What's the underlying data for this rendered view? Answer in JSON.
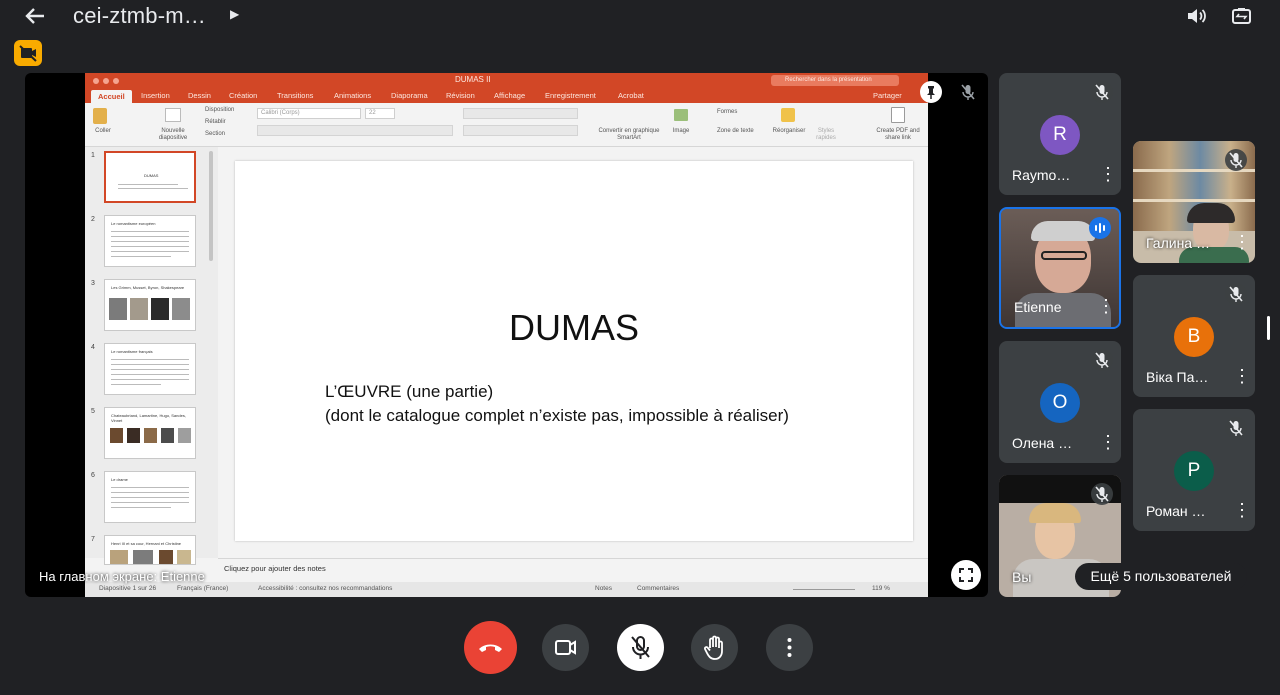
{
  "meeting": {
    "title": "cei-ztmb-m…"
  },
  "presentation": {
    "caption": "На главном экране: Etienne",
    "app": {
      "doc_title": "DUMAS II",
      "search_placeholder": "Rechercher dans la présentation",
      "share": "Partager",
      "tabs": [
        "Accueil",
        "Insertion",
        "Dessin",
        "Création",
        "Transitions",
        "Animations",
        "Diaporama",
        "Révision",
        "Affichage",
        "Enregistrement",
        "Acrobat"
      ],
      "ribbon": {
        "coller": "Coller",
        "nouvelle": "Nouvelle diapositive",
        "disposition": "Disposition",
        "retablir": "Rétablir",
        "section": "Section",
        "font": "Calibri (Corps)",
        "size": "22",
        "convert": "Convertir en graphique SmartArt",
        "image": "Image",
        "formes": "Formes",
        "zone": "Zone de texte",
        "reorg": "Réorganiser",
        "styles": "Styles rapides",
        "pdf": "Create PDF and share link"
      },
      "thumbs": [
        {
          "num": "1",
          "title": "DUMAS"
        },
        {
          "num": "2",
          "title": "Le romantisme européen"
        },
        {
          "num": "3",
          "title": "Les Grimm, Musset, Byron, Shakespeare"
        },
        {
          "num": "4",
          "title": "Le romantisme français"
        },
        {
          "num": "5",
          "title": "Chateaubriand, Lamartine, Hugo, Sandes, Vinnet"
        },
        {
          "num": "6",
          "title": "Le drame"
        },
        {
          "num": "7",
          "title": "Henri III et sa cour, Hernani et Christine"
        }
      ],
      "slide": {
        "title": "DUMAS",
        "line1": "L’ŒUVRE  (une partie)",
        "line2": "(dont le catalogue complet n’existe pas, impossible à réaliser)"
      },
      "notes_placeholder": "Cliquez pour ajouter des notes",
      "status": {
        "slide": "Diapositive 1 sur 26",
        "lang": "Français (France)",
        "access": "Accessibilité : consultez nos recommandations",
        "notes": "Notes",
        "comments": "Commentaires",
        "zoom": "119 %"
      }
    }
  },
  "participants": [
    {
      "name": "Raymo…",
      "initial": "R",
      "color": "#7e57c2"
    },
    {
      "name": "Etienne",
      "speaking": true
    },
    {
      "name": "Олена …",
      "initial": "О",
      "color": "#1565c0"
    },
    {
      "name": "Вы"
    },
    {
      "name": "Галина …"
    },
    {
      "name": "Віка Па…",
      "initial": "В",
      "color": "#e8710a"
    },
    {
      "name": "Роман …",
      "initial": "Р",
      "color": "#0b5d4a"
    }
  ],
  "more_users": "Ещё 5 пользователей",
  "icons": [
    "back-arrow-icon",
    "volume-icon",
    "camera-switch-icon",
    "no-video-icon",
    "pin-icon",
    "mic-off-icon",
    "fullscreen-icon",
    "end-call-icon",
    "camera-icon",
    "hand-icon",
    "more-vert-icon"
  ]
}
